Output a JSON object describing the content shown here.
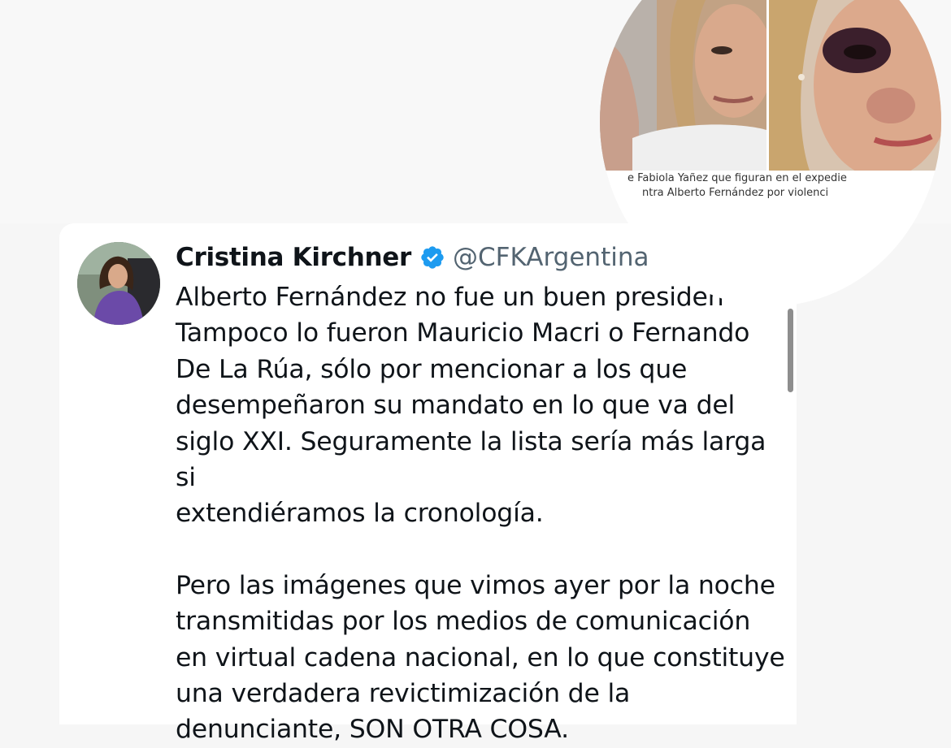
{
  "tweet": {
    "author_name": "Cristina Kirchner",
    "verified_icon": "verified-badge-icon",
    "handle": "@CFKArgentina",
    "paragraphs": [
      "Alberto Fernández no fue un buen presiden\nTampoco lo fueron Mauricio Macri o Fernando\nDe La Rúa, sólo por mencionar a los que\ndesempeñaron su mandato en lo que va del\nsiglo XXI. Seguramente la lista sería más larga si\nextendiéramos la cronología.",
      "Pero las imágenes que vimos ayer por la noche\ntransmitidas por los medios de comunicación\nen virtual cadena nacional, en lo que constituye\nuna verdadera revictimización de la\ndenunciante, SON OTRA COSA."
    ]
  },
  "overlay_photo": {
    "caption_line1": "e Fabiola Yañez que figuran en el expedie",
    "caption_line2": "ntra Alberto Fernández por violenci"
  },
  "colors": {
    "text": "#0f1419",
    "handle": "#536471",
    "verified": "#1d9bf0"
  }
}
